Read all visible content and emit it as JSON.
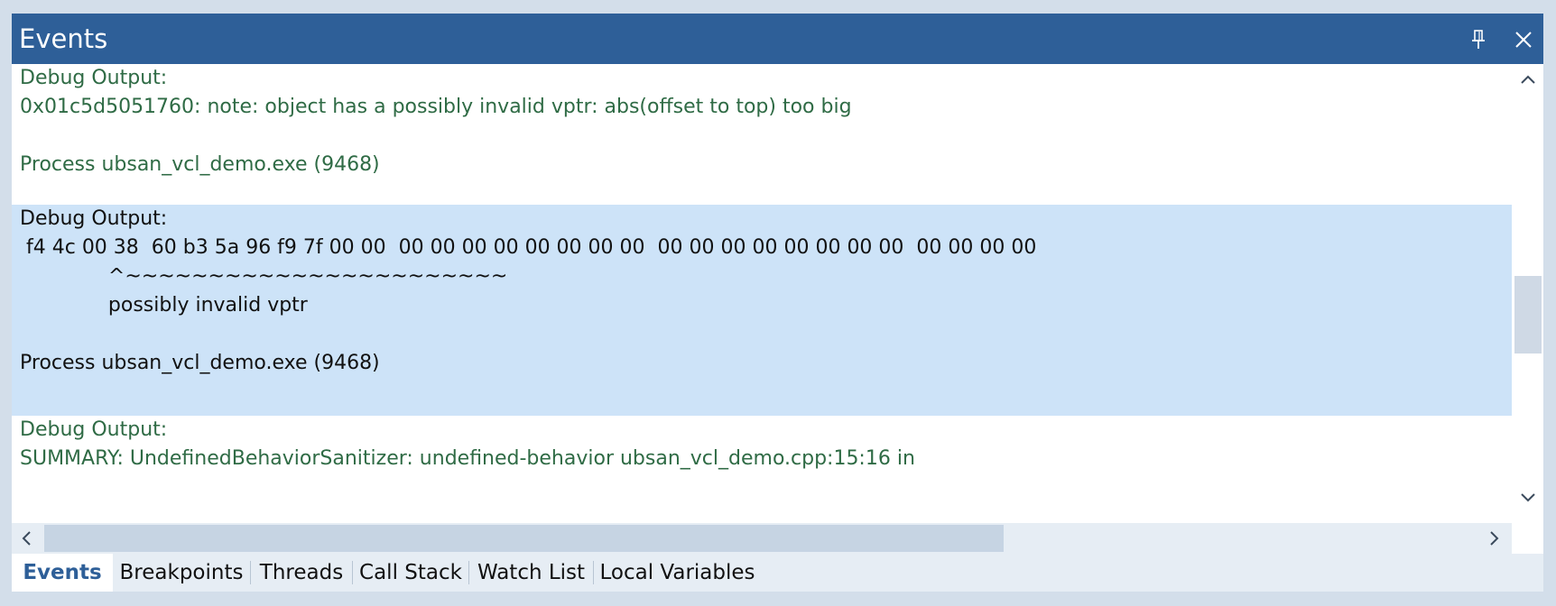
{
  "window": {
    "title": "Events",
    "title_bar_color": "#2e5f98",
    "buttons": [
      "pin-icon",
      "close-icon"
    ]
  },
  "events": [
    {
      "lines": [
        "Debug Output:",
        "0x01c5d5051760: note: object has a possibly invalid vptr: abs(offset to top) too big",
        "",
        "Process ubsan_vcl_demo.exe (9468)"
      ]
    },
    {
      "lines": [
        "Debug Output:",
        " f4 4c 00 38  60 b3 5a 96 f9 7f 00 00  00 00 00 00 00 00 00 00  00 00 00 00 00 00 00 00  00 00 00 00",
        "              ^~~~~~~~~~~~~~~~~~~~~~~~",
        "              possibly invalid vptr",
        "",
        "Process ubsan_vcl_demo.exe (9468)"
      ]
    },
    {
      "lines": [
        "Debug Output:",
        "SUMMARY: UndefinedBehaviorSanitizer: undefined-behavior ubsan_vcl_demo.cpp:15:16 in"
      ]
    }
  ],
  "colors": {
    "event_text": "#2f6b45",
    "selected_background": "#cde3f8"
  },
  "tabs": [
    {
      "label": "Events",
      "active": true
    },
    {
      "label": "Breakpoints",
      "active": false
    },
    {
      "label": "Threads",
      "active": false
    },
    {
      "label": "Call Stack",
      "active": false
    },
    {
      "label": "Watch List",
      "active": false
    },
    {
      "label": "Local Variables",
      "active": false
    }
  ]
}
